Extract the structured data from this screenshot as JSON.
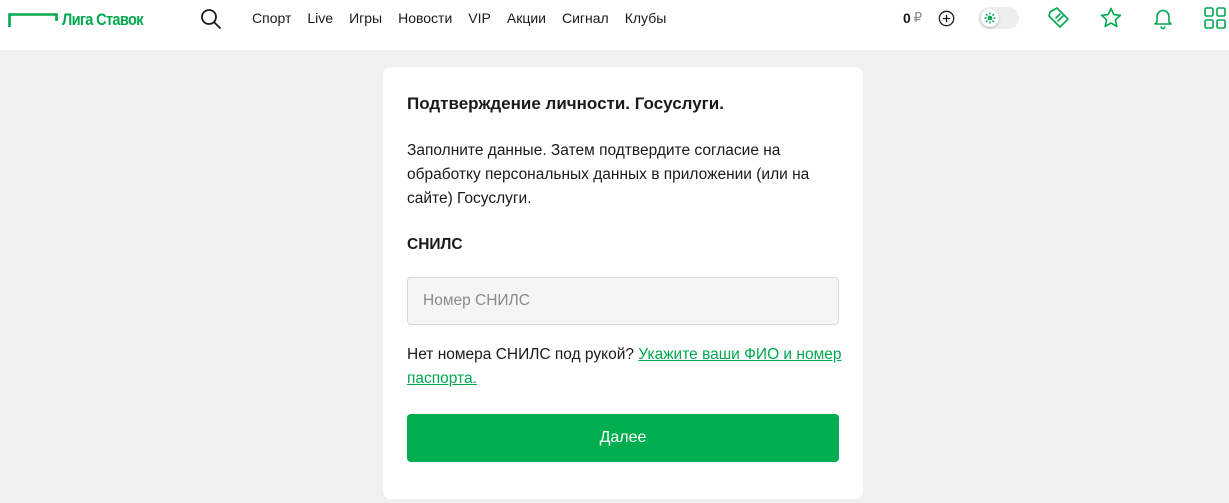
{
  "header": {
    "logo_text": "Лига Ставок",
    "nav": [
      "Спорт",
      "Live",
      "Игры",
      "Новости",
      "VIP",
      "Акции",
      "Сигнал",
      "Клубы"
    ],
    "balance": {
      "amount": "0",
      "currency": "₽"
    }
  },
  "card": {
    "title": "Подтверждение личности. Госуслуги.",
    "description": "Заполните данные. Затем подтвердите согласие на обработку персональных данных в приложении (или на сайте) Госуслуги.",
    "field_label": "СНИЛС",
    "input_value": "",
    "input_placeholder": "Номер СНИЛС",
    "hint_text": "Нет номера СНИЛС под рукой? ",
    "hint_link": "Укажите ваши ФИО и номер паспорта.",
    "submit_label": "Далее"
  },
  "colors": {
    "brand": "#00a84f",
    "button": "#00ad4f",
    "page_bg": "#f0f0f0"
  },
  "icons": {
    "search": "search-icon",
    "add": "plus-circle-icon",
    "toggle": "theme-toggle-icon",
    "coupon": "coupon-icon",
    "favorites": "star-icon",
    "notifications": "bell-icon",
    "menu": "grid-icon"
  }
}
